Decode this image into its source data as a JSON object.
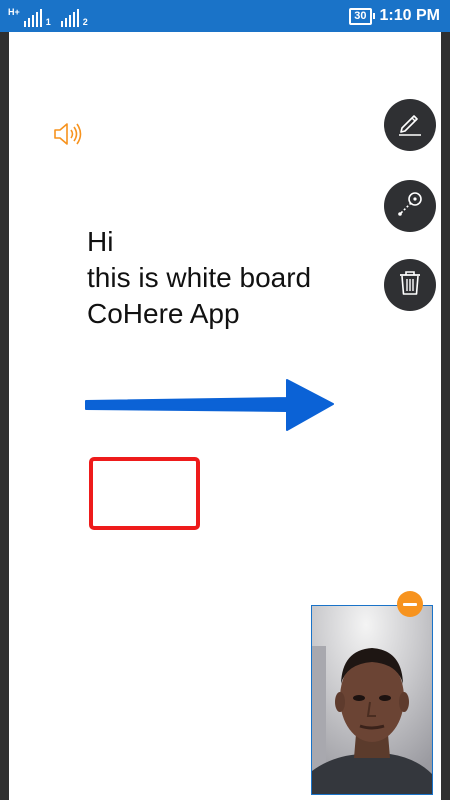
{
  "status_bar": {
    "network_type": "H+",
    "sim1_label": "1",
    "sim2_label": "2",
    "battery_level": "30",
    "time": "1:10 PM"
  },
  "whiteboard": {
    "text_lines": [
      "Hi",
      "this is white board",
      "CoHere App"
    ],
    "arrow_color": "#0b62d6",
    "rectangle_color": "#ee1b1b",
    "speaker_icon_color": "#f7931e"
  },
  "tools": [
    {
      "name": "pen",
      "icon": "pen-icon"
    },
    {
      "name": "shape",
      "icon": "circle-line-icon"
    },
    {
      "name": "delete",
      "icon": "trash-icon"
    }
  ],
  "video_preview": {
    "minimize_icon": "minus-icon",
    "minimize_color": "#f7931e",
    "border_color": "#1a73c8"
  }
}
